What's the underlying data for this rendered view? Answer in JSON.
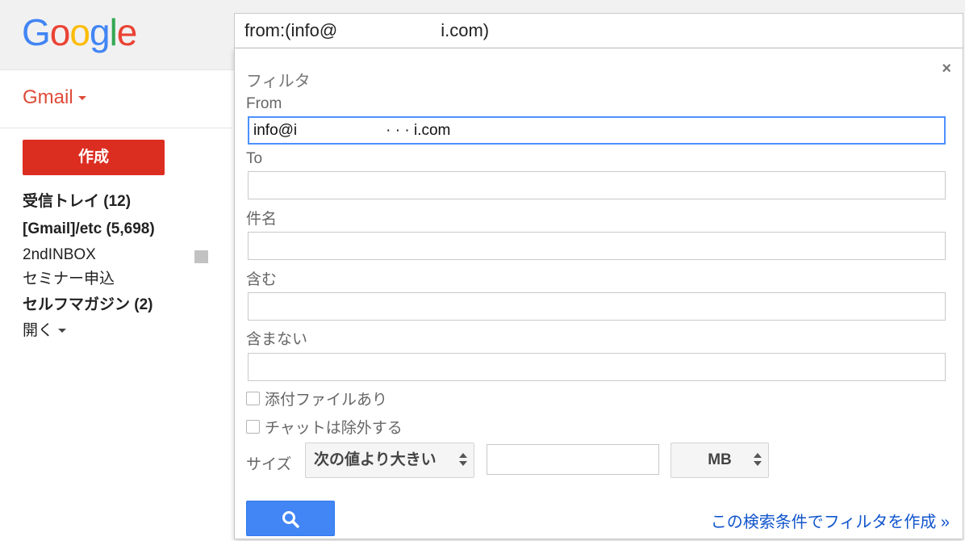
{
  "header": {
    "logo_letters": [
      "G",
      "o",
      "o",
      "g",
      "l",
      "e"
    ],
    "logo_colors": [
      "#4285f4",
      "#ea4335",
      "#fbbc05",
      "#4285f4",
      "#34a853",
      "#ea4335"
    ],
    "search_prefix": "from:(info@",
    "search_suffix": "i.com)"
  },
  "sidebar": {
    "app_label": "Gmail",
    "compose_label": "作成",
    "items": [
      {
        "label": "受信トレイ (12)"
      },
      {
        "label": "[Gmail]/etc (5,698)"
      },
      {
        "label": "2ndINBOX"
      },
      {
        "label": "セミナー申込"
      },
      {
        "label": "セルフマガジン (2)"
      },
      {
        "label": "開く"
      }
    ]
  },
  "filter": {
    "title": "フィルタ",
    "close_glyph": "×",
    "from_label": "From",
    "from_value_prefix": "info@i",
    "from_value_suffix": "· · ·  i.com",
    "to_label": "To",
    "subject_label": "件名",
    "has_words_label": "含む",
    "doesnt_have_label": "含まない",
    "has_attachment_label": "添付ファイルあり",
    "exclude_chats_label": "チャットは除外する",
    "size_label": "サイズ",
    "size_operator": "次の値より大きい",
    "size_unit": "MB",
    "search_icon": "search-icon",
    "create_filter_link": "この検索条件でフィルタを作成 »"
  },
  "colors": {
    "compose_red": "#dc2d21",
    "gmail_red": "#dd4b39",
    "focus_blue": "#4d90fe",
    "search_button_blue": "#4285f4",
    "link_blue": "#1155cc"
  }
}
